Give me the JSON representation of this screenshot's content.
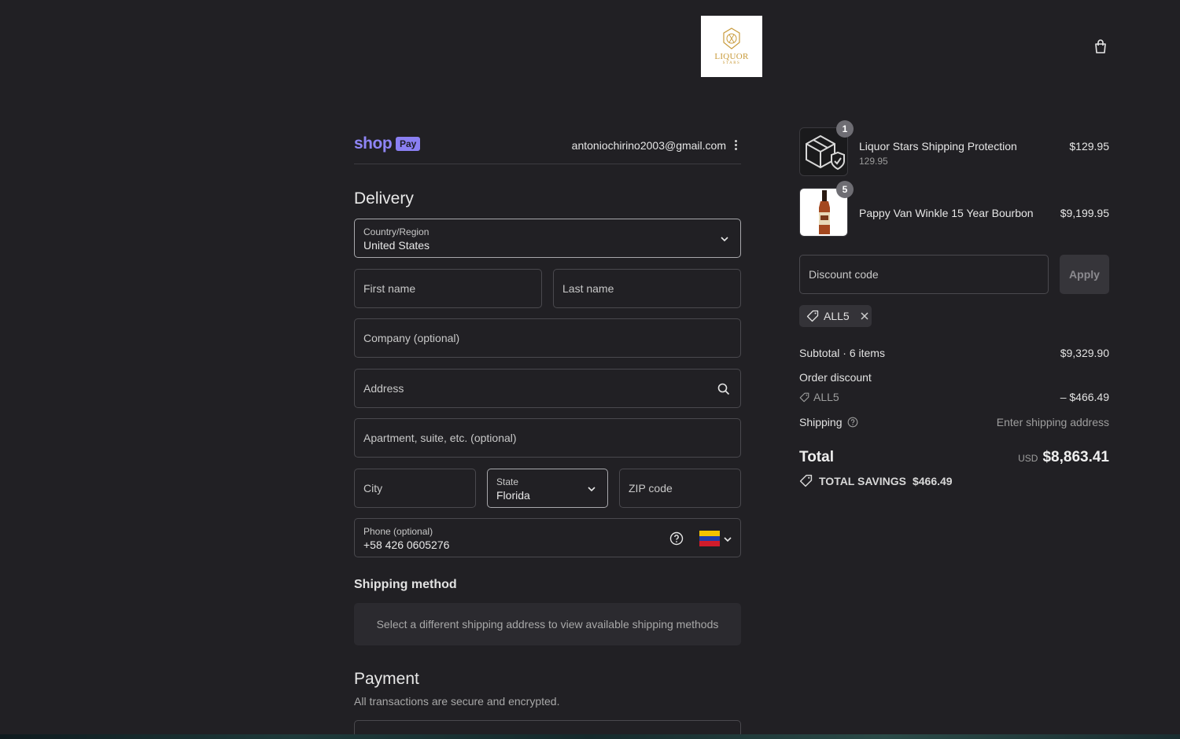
{
  "header": {
    "logo_text": "LIQUOR",
    "logo_sub": "STARS",
    "cart_icon": "shopping-bag-icon"
  },
  "shop_pay": {
    "brand": "shop",
    "badge": "Pay",
    "email": "antoniochirino2003@gmail.com"
  },
  "delivery": {
    "title": "Delivery",
    "country": {
      "label": "Country/Region",
      "value": "United States"
    },
    "first_name": "First name",
    "last_name": "Last name",
    "company": "Company (optional)",
    "address": "Address",
    "apartment": "Apartment, suite, etc. (optional)",
    "city": "City",
    "state": {
      "label": "State",
      "value": "Florida"
    },
    "zip": "ZIP code",
    "phone": {
      "label": "Phone (optional)",
      "value": "+58 426 0605276",
      "flag": "venezuela-flag"
    }
  },
  "shipping_method": {
    "title": "Shipping method",
    "message": "Select a different shipping address to view available shipping methods"
  },
  "payment": {
    "title": "Payment",
    "note": "All transactions are secure and encrypted."
  },
  "order": {
    "items": [
      {
        "qty": "1",
        "name": "Liquor Stars Shipping Protection",
        "sub": "129.95",
        "price": "$129.95"
      },
      {
        "qty": "5",
        "name": "Pappy Van Winkle 15 Year Bourbon",
        "sub": "",
        "price": "$9,199.95"
      }
    ],
    "discount_placeholder": "Discount code",
    "apply_label": "Apply",
    "applied_code": "ALL5",
    "subtotal_label": "Subtotal · 6 items",
    "subtotal_value": "$9,329.90",
    "order_discount_label": "Order discount",
    "order_discount_code": "ALL5",
    "order_discount_value": "– $466.49",
    "shipping_label": "Shipping",
    "shipping_value": "Enter shipping address",
    "total_label": "Total",
    "total_currency": "USD",
    "total_value": "$8,863.41",
    "savings_label": "TOTAL SAVINGS",
    "savings_value": "$466.49"
  },
  "colors": {
    "background": "#212024",
    "shop_pay_purple": "#8a7ff2",
    "logo_gold": "#c89a3a"
  }
}
